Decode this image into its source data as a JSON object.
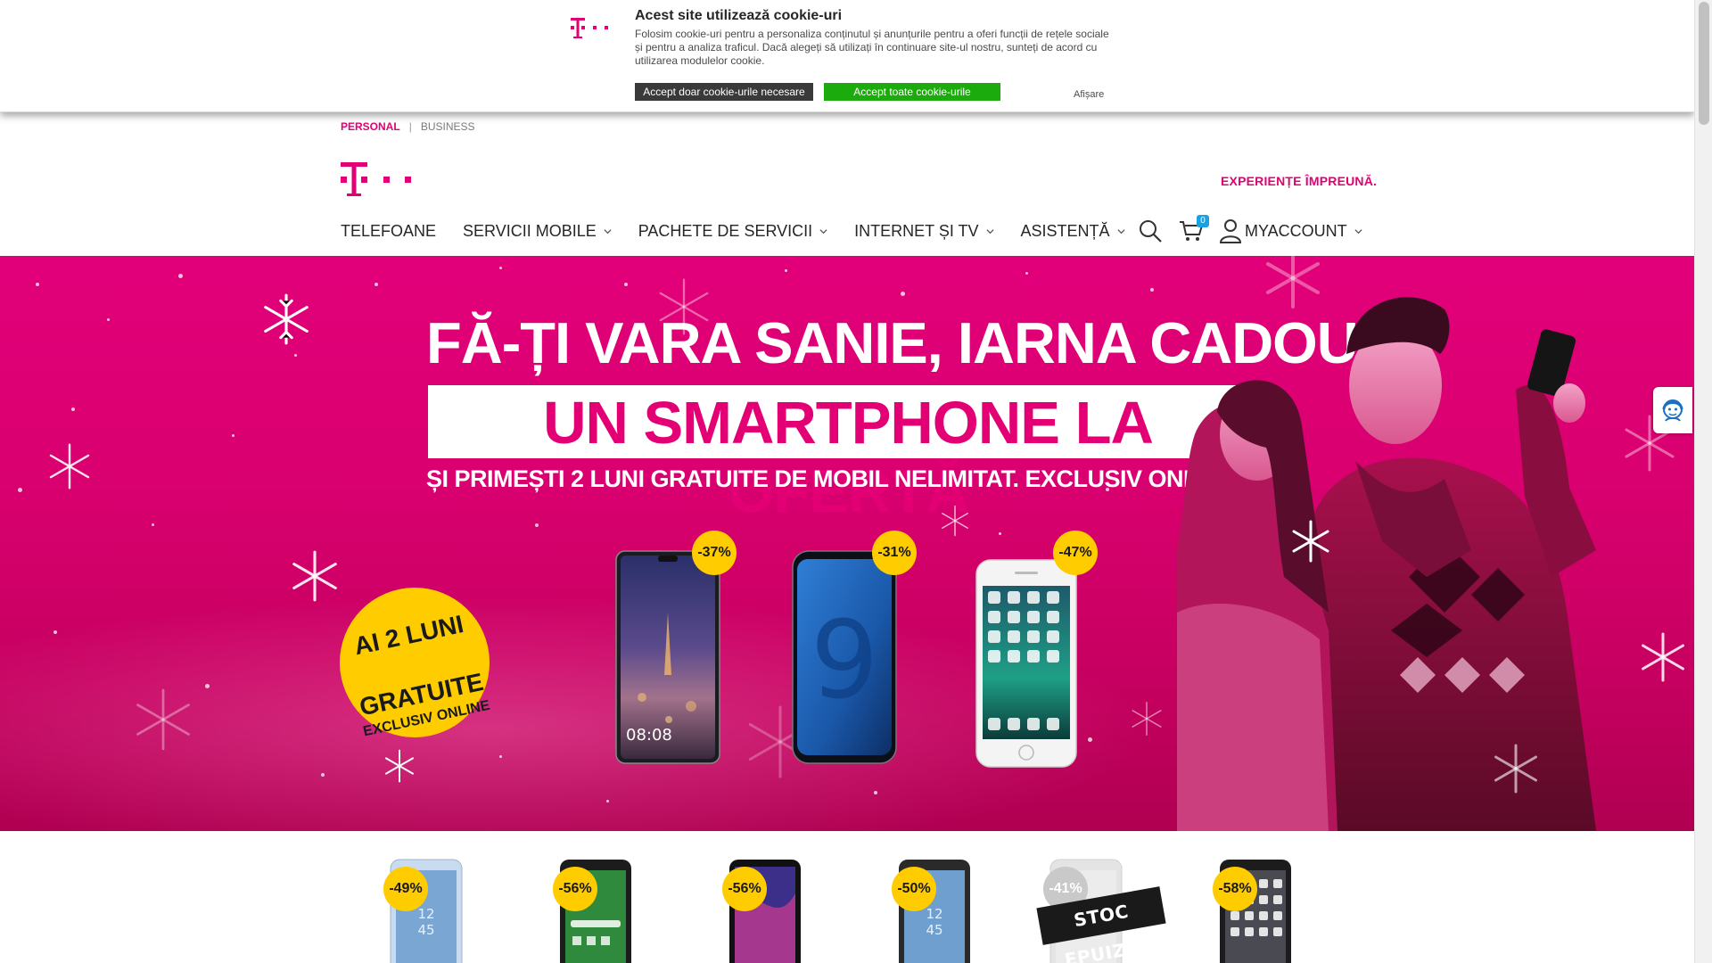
{
  "cookie_banner": {
    "title": "Acest site utilizează cookie-uri",
    "text": "Folosim cookie-uri pentru a personaliza conținutul și anunțurile pentru a oferi funcții de rețele sociale și pentru a analiza traficul. Dacă alegeți să utilizați în continuare site-ul nostru, sunteți de acord cu utilizarea modulelor cookie.",
    "btn_necessary": "Accept doar cookie-urile necesare",
    "btn_all": "Accept toate cookie-urile",
    "show_link": "Afișare"
  },
  "segment": {
    "personal": "PERSONAL",
    "separator": "|",
    "business": "BUSINESS"
  },
  "header": {
    "tagline": "EXPERIENȚE ÎMPREUNĂ.",
    "cart_count": "0",
    "account_label": "MYACCOUNT"
  },
  "nav": {
    "items": [
      {
        "label": "TELEFOANE",
        "has_dropdown": false
      },
      {
        "label": "SERVICII MOBILE",
        "has_dropdown": true
      },
      {
        "label": "PACHETE DE SERVICII",
        "has_dropdown": true
      },
      {
        "label": "INTERNET ȘI TV",
        "has_dropdown": true
      },
      {
        "label": "ASISTENȚĂ",
        "has_dropdown": true
      }
    ]
  },
  "hero": {
    "headline": "FĂ-ȚI VARA SANIE, IARNA CADOU",
    "highlight": "UN SMARTPHONE LA OFERTĂ",
    "subline": "ȘI PRIMEȘTI 2 LUNI GRATUITE DE MOBIL NELIMITAT. EXCLUSIV ONLINE.",
    "badge_line1": "AI 2 LUNI",
    "badge_line2": "GRATUITE",
    "badge_line3": "EXCLUSIV ONLINE",
    "phones": [
      {
        "discount": "-37%",
        "screen_time": "08:08"
      },
      {
        "discount": "-31%",
        "screen_text": "9"
      },
      {
        "discount": "-47%"
      }
    ]
  },
  "products": [
    {
      "discount": "-49%"
    },
    {
      "discount": "-56%"
    },
    {
      "discount": "-56%"
    },
    {
      "discount": "-50%"
    },
    {
      "discount": "-41%",
      "sold_out": true
    },
    {
      "discount": "-58%"
    }
  ],
  "stock_label": "STOC EPUIZAT",
  "colors": {
    "brand_magenta": "#e20074",
    "discount_yellow": "#ffcc00",
    "accept_green": "#1cab0c"
  }
}
